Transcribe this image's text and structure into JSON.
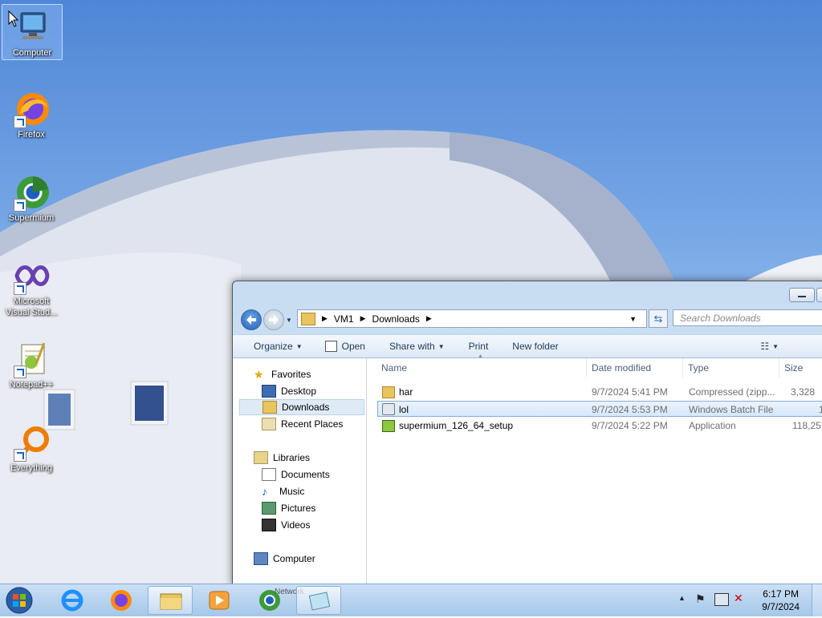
{
  "desktop": {
    "icons": [
      {
        "label": "Computer",
        "icon": "computer-icon"
      },
      {
        "label": "Firefox",
        "icon": "firefox-icon"
      },
      {
        "label": "Supermium",
        "icon": "supermium-icon"
      },
      {
        "label": "Microsoft Visual Stud...",
        "icon": "visual-studio-icon"
      },
      {
        "label": "Notepad++",
        "icon": "notepadpp-icon"
      },
      {
        "label": "Everything",
        "icon": "everything-icon"
      }
    ]
  },
  "explorer": {
    "breadcrumb": [
      "VM1",
      "Downloads"
    ],
    "search_placeholder": "Search Downloads",
    "toolbar": {
      "organize": "Organize",
      "open": "Open",
      "share_with": "Share with",
      "print": "Print",
      "new_folder": "New folder"
    },
    "nav": {
      "favorites": "Favorites",
      "desktop": "Desktop",
      "downloads": "Downloads",
      "recent_places": "Recent Places",
      "libraries": "Libraries",
      "documents": "Documents",
      "music": "Music",
      "pictures": "Pictures",
      "videos": "Videos",
      "computer": "Computer"
    },
    "columns": {
      "name": "Name",
      "date_modified": "Date modified",
      "type": "Type",
      "size": "Size"
    },
    "files": [
      {
        "name": "har",
        "date": "9/7/2024 5:41 PM",
        "type": "Compressed (zipp...",
        "size": "3,328",
        "icon": "zip-folder-icon"
      },
      {
        "name": "lol",
        "date": "9/7/2024 5:53 PM",
        "type": "Windows Batch File",
        "size": "1",
        "icon": "batch-file-icon",
        "selected": true
      },
      {
        "name": "supermium_126_64_setup",
        "date": "9/7/2024 5:22 PM",
        "type": "Application",
        "size": "118,257",
        "icon": "installer-icon"
      }
    ]
  },
  "taskbar": {
    "time": "6:17 PM",
    "date": "9/7/2024",
    "network_label": "Network"
  },
  "colors": {
    "selection_bg": "#d6e8fb",
    "selection_border": "#84acdd",
    "link_blue": "#1e395b"
  }
}
